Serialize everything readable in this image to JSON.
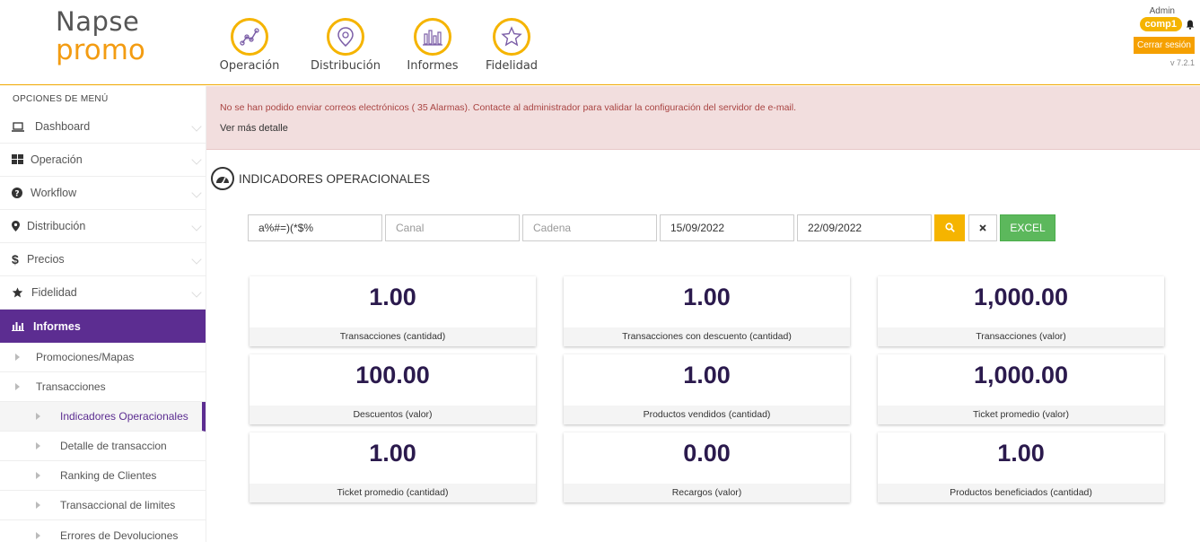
{
  "header": {
    "logo_line1": "Napse",
    "logo_line2": "promo",
    "nav": [
      {
        "label": "Operación",
        "icon": "scatter-graph-icon"
      },
      {
        "label": "Distribución",
        "icon": "map-pin-icon"
      },
      {
        "label": "Informes",
        "icon": "bar-chart-icon"
      },
      {
        "label": "Fidelidad",
        "icon": "star-icon"
      }
    ],
    "user": "Admin",
    "company": "comp1",
    "logout_label": "Cerrar sesión",
    "version": "v 7.2.1"
  },
  "sidebar": {
    "title": "OPCIONES DE MENÚ",
    "items": [
      {
        "label": "Dashboard",
        "icon": "laptop-icon"
      },
      {
        "label": "Operación",
        "icon": "grid-icon"
      },
      {
        "label": "Workflow",
        "icon": "question-circle-icon"
      },
      {
        "label": "Distribución",
        "icon": "map-marker-icon"
      },
      {
        "label": "Precios",
        "icon": "dollar-icon"
      },
      {
        "label": "Fidelidad",
        "icon": "star-icon"
      },
      {
        "label": "Informes",
        "icon": "bar-chart-icon"
      }
    ],
    "sub_items": [
      {
        "label": "Promociones/Mapas"
      },
      {
        "label": "Transacciones"
      }
    ],
    "sub2_items": [
      {
        "label": "Indicadores Operacionales"
      },
      {
        "label": "Detalle de transaccion"
      },
      {
        "label": "Ranking de Clientes"
      },
      {
        "label": "Transaccional de limites"
      },
      {
        "label": "Errores de Devoluciones"
      }
    ]
  },
  "alert": {
    "message": "No se han podido enviar correos electrónicos ( 35 Alarmas). Contacte al administrador para validar la configuración del servidor de e-mail.",
    "link": "Ver más detalle"
  },
  "section": {
    "title": "INDICADORES OPERACIONALES"
  },
  "filters": {
    "field1_value": "a%#=)(*$%",
    "canal_placeholder": "Canal",
    "cadena_placeholder": "Cadena",
    "date_from": "15/09/2022",
    "date_to": "22/09/2022",
    "excel_label": "EXCEL"
  },
  "cards": [
    {
      "value": "1.00",
      "label": "Transacciones (cantidad)"
    },
    {
      "value": "1.00",
      "label": "Transacciones con descuento (cantidad)"
    },
    {
      "value": "1,000.00",
      "label": "Transacciones (valor)"
    },
    {
      "value": "100.00",
      "label": "Descuentos (valor)"
    },
    {
      "value": "1.00",
      "label": "Productos vendidos (cantidad)"
    },
    {
      "value": "1,000.00",
      "label": "Ticket promedio (valor)"
    },
    {
      "value": "1.00",
      "label": "Ticket promedio (cantidad)"
    },
    {
      "value": "0.00",
      "label": "Recargos (valor)"
    },
    {
      "value": "1.00",
      "label": "Productos beneficiados (cantidad)"
    }
  ],
  "colors": {
    "accent": "#f5b400",
    "brand_purple": "#5c2d91",
    "alert_bg": "#f2dede",
    "excel_green": "#5cb85c"
  }
}
